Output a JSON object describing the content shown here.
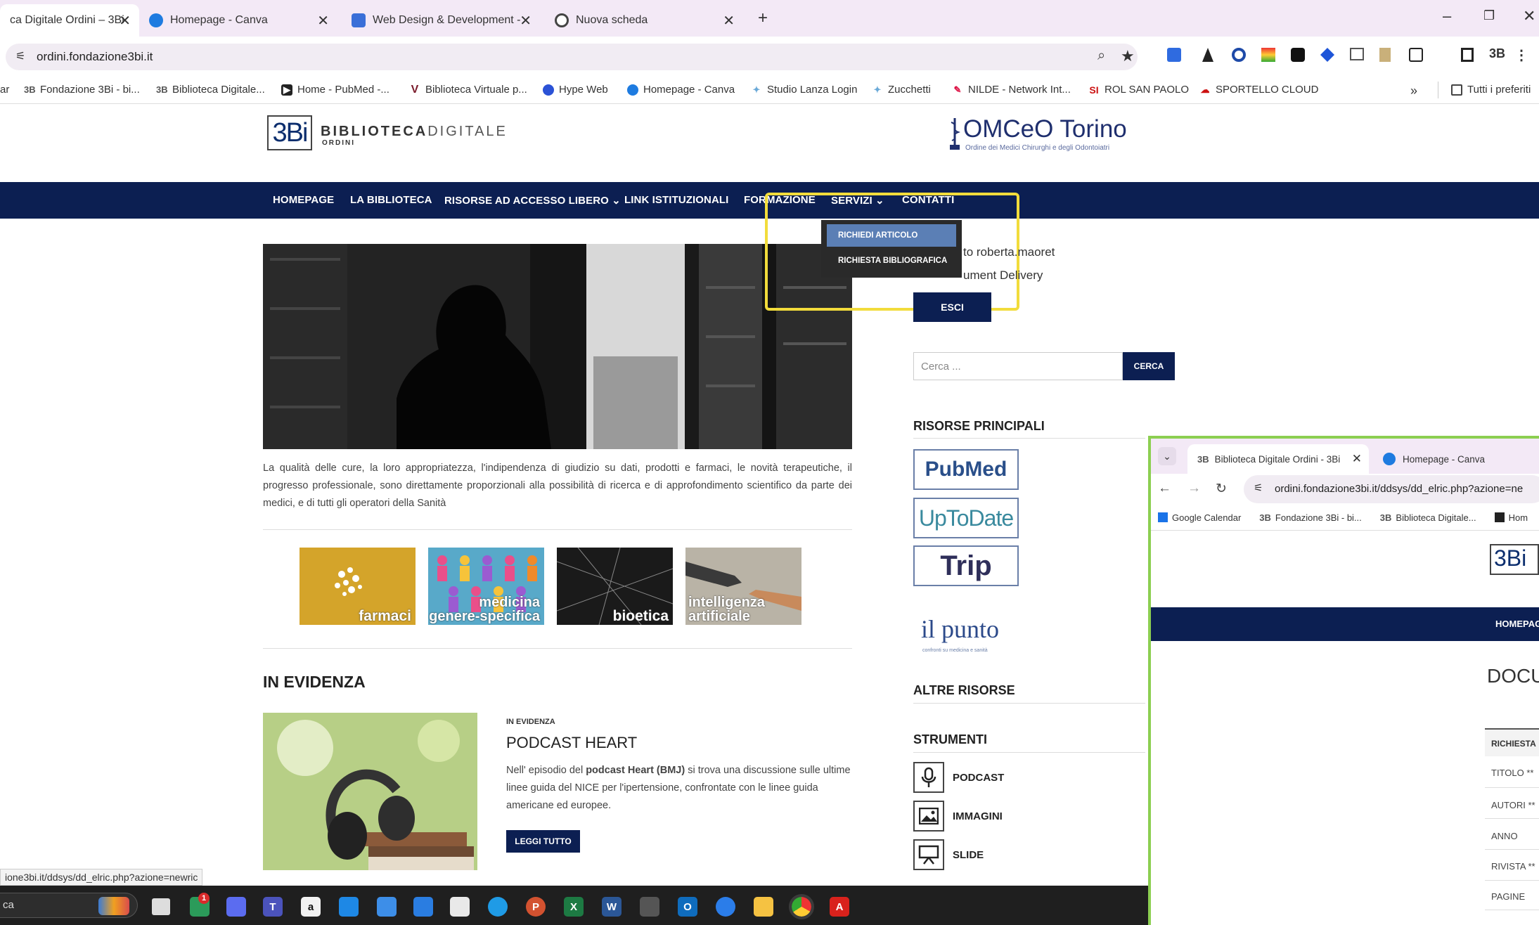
{
  "browser": {
    "tabs": [
      {
        "title": "ca Digitale Ordini – 3Bi",
        "active": true
      },
      {
        "title": "Homepage - Canva",
        "active": false
      },
      {
        "title": "Web Design & Development - ",
        "active": false
      },
      {
        "title": "Nuova scheda",
        "active": false
      }
    ],
    "new_tab": "+",
    "url": "ordini.fondazione3bi.it",
    "bookmarks": [
      {
        "label": "ar"
      },
      {
        "label": "Fondazione 3Bi - bi..."
      },
      {
        "label": "Biblioteca Digitale..."
      },
      {
        "label": "Home - PubMed -..."
      },
      {
        "label": "Biblioteca Virtuale p..."
      },
      {
        "label": "Hype Web"
      },
      {
        "label": "Homepage - Canva"
      },
      {
        "label": "Studio Lanza Login"
      },
      {
        "label": "Zucchetti"
      },
      {
        "label": "NILDE - Network Int..."
      },
      {
        "label": "ROL SAN PAOLO"
      },
      {
        "label": "SPORTELLO CLOUD"
      }
    ],
    "bookmarks_overflow": "»",
    "all_bookmarks": "Tutti i preferiti",
    "status_url": "ione3bi.it/ddsys/dd_elric.php?azione=newric"
  },
  "site": {
    "logo_text": "BIBLIOTECA",
    "logo_text_light": "DIGITALE",
    "logo_sub": "ORDINI",
    "logo_badge": "3Bi",
    "partner_title": "OMCeO Torino",
    "partner_sub": "Ordine dei Medici Chirurghi e degli Odontoiatri",
    "nav": [
      {
        "label": "HOMEPAGE"
      },
      {
        "label": "LA BIBLIOTECA"
      },
      {
        "label": "RISORSE AD ACCESSO LIBERO ⌄"
      },
      {
        "label": "LINK ISTITUZIONALI"
      },
      {
        "label": "FORMAZIONE"
      },
      {
        "label": "SERVIZI ⌄"
      },
      {
        "label": "CONTATTI"
      }
    ],
    "dropdown": [
      "RICHIEDI ARTICOLO",
      "RICHIESTA BIBLIOGRAFICA"
    ],
    "user_line1": "to roberta.maoret",
    "user_line2": "ument Delivery",
    "logout_button": "ESCI",
    "search_placeholder": "Cerca ...",
    "search_button": "CERCA",
    "caption": "La qualità delle cure, la loro appropriatezza, l'indipendenza di giudizio su dati, prodotti e farmaci, le novità terapeutiche, il progresso professionale, sono direttamente proporzionali alla possibilità di ricerca e di approfondimento scientifico da parte dei medici, e di tutti gli operatori della Sanità",
    "categories": [
      {
        "label": "farmaci",
        "color": "#d4a42a"
      },
      {
        "label": "medicina genere-specifica",
        "color": "#58a9c9"
      },
      {
        "label": "bioetica",
        "color": "#1a1a1a"
      },
      {
        "label": "intelligenza artificiale",
        "color": "#8a8478"
      }
    ],
    "section_title": "IN EVIDENZA",
    "post": {
      "tag": "IN EVIDENZA",
      "title": "PODCAST HEART",
      "body_pre": "Nell' episodio del ",
      "body_bold1": "podcast Heart (BMJ)",
      "body_post": " si trova una discussione sulle ultime linee guida del NICE per l'ipertensione, confrontate con le linee guida americane ed europee.",
      "button": "LEGGI TUTTO"
    },
    "sidebar": {
      "main_resources_title": "RISORSE PRINCIPALI",
      "resources": [
        "PubMed",
        "UpToDate",
        "Trip"
      ],
      "ilpunto": "il punto",
      "ilpunto_sub": "confronti su medicina e sanità",
      "other_resources_title": "ALTRE RISORSE",
      "tools_title": "STRUMENTI",
      "tools": [
        "PODCAST",
        "IMMAGINI",
        "SLIDE"
      ]
    }
  },
  "taskbar": {
    "search_text": "ca",
    "notification_count": "1"
  },
  "second_window": {
    "tabs": [
      "Biblioteca Digitale Ordini - 3Bi",
      "Homepage - Canva"
    ],
    "url": "ordini.fondazione3bi.it/ddsys/dd_elric.php?azione=ne",
    "bookmarks": [
      "Google Calendar",
      "Fondazione 3Bi - bi...",
      "Biblioteca Digitale...",
      "Hom"
    ],
    "nav_item": "HOMEPAG",
    "heading": "DOCUI",
    "form_header": "RICHIESTA",
    "form_rows": [
      "TITOLO **",
      "AUTORI **",
      "ANNO",
      "RIVISTA **",
      "PAGINE"
    ]
  },
  "colors": {
    "nav_bg": "#0c1f52",
    "highlight": "#f2dc3b",
    "accent_green": "#8ccf51",
    "dropdown_selected": "#5b7fb5"
  }
}
